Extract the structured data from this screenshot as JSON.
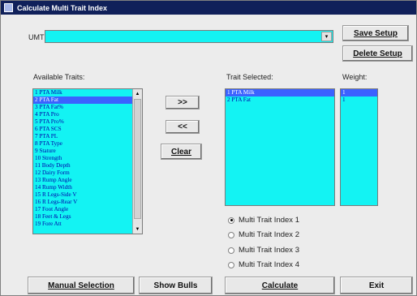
{
  "window": {
    "title": "Calculate Multi Trait Index"
  },
  "umti": {
    "label": "UMTI:",
    "value": "",
    "dropdown_symbol": "▾"
  },
  "buttons": {
    "save_setup": "Save Setup",
    "delete_setup": "Delete Setup",
    "add": ">>",
    "remove": "<<",
    "clear": "Clear",
    "manual_selection": "Manual Selection",
    "show_bulls": "Show Bulls",
    "calculate": "Calculate",
    "exit": "Exit"
  },
  "available": {
    "label": "Available Traits:",
    "items": [
      "1 PTA Milk",
      "2 PTA Fat",
      "3 PTA Fat%",
      "4 PTA Pro",
      "5 PTA Pro%",
      "6 PTA SCS",
      "7 PTA PL",
      "8 PTA Type",
      "9 Stature",
      "10 Strength",
      "11 Body Depth",
      "12 Dairy Form",
      "13 Rump Angle",
      "14 Rump Width",
      "15 R Legs-Side V",
      "16 R Legs-Rear V",
      "17 Foot Angle",
      "18 Feet & Legs",
      "19 Fore Att"
    ],
    "selected_index": 1
  },
  "selected": {
    "label": "Trait Selected:",
    "items": [
      "1 PTA Milk",
      "2 PTA Fat"
    ],
    "selected_index": 0
  },
  "weight": {
    "label": "Weight:",
    "items": [
      "1",
      "1"
    ],
    "selected_index": 0
  },
  "radios": [
    {
      "label": "Multi Trait Index 1",
      "checked": true
    },
    {
      "label": "Multi Trait Index 2",
      "checked": false
    },
    {
      "label": "Multi Trait Index 3",
      "checked": false
    },
    {
      "label": "Multi Trait Index 4",
      "checked": false
    }
  ],
  "colors": {
    "list_bg": "#13f3f3",
    "selection": "#3b62ff",
    "title_bar": "#10205a"
  }
}
